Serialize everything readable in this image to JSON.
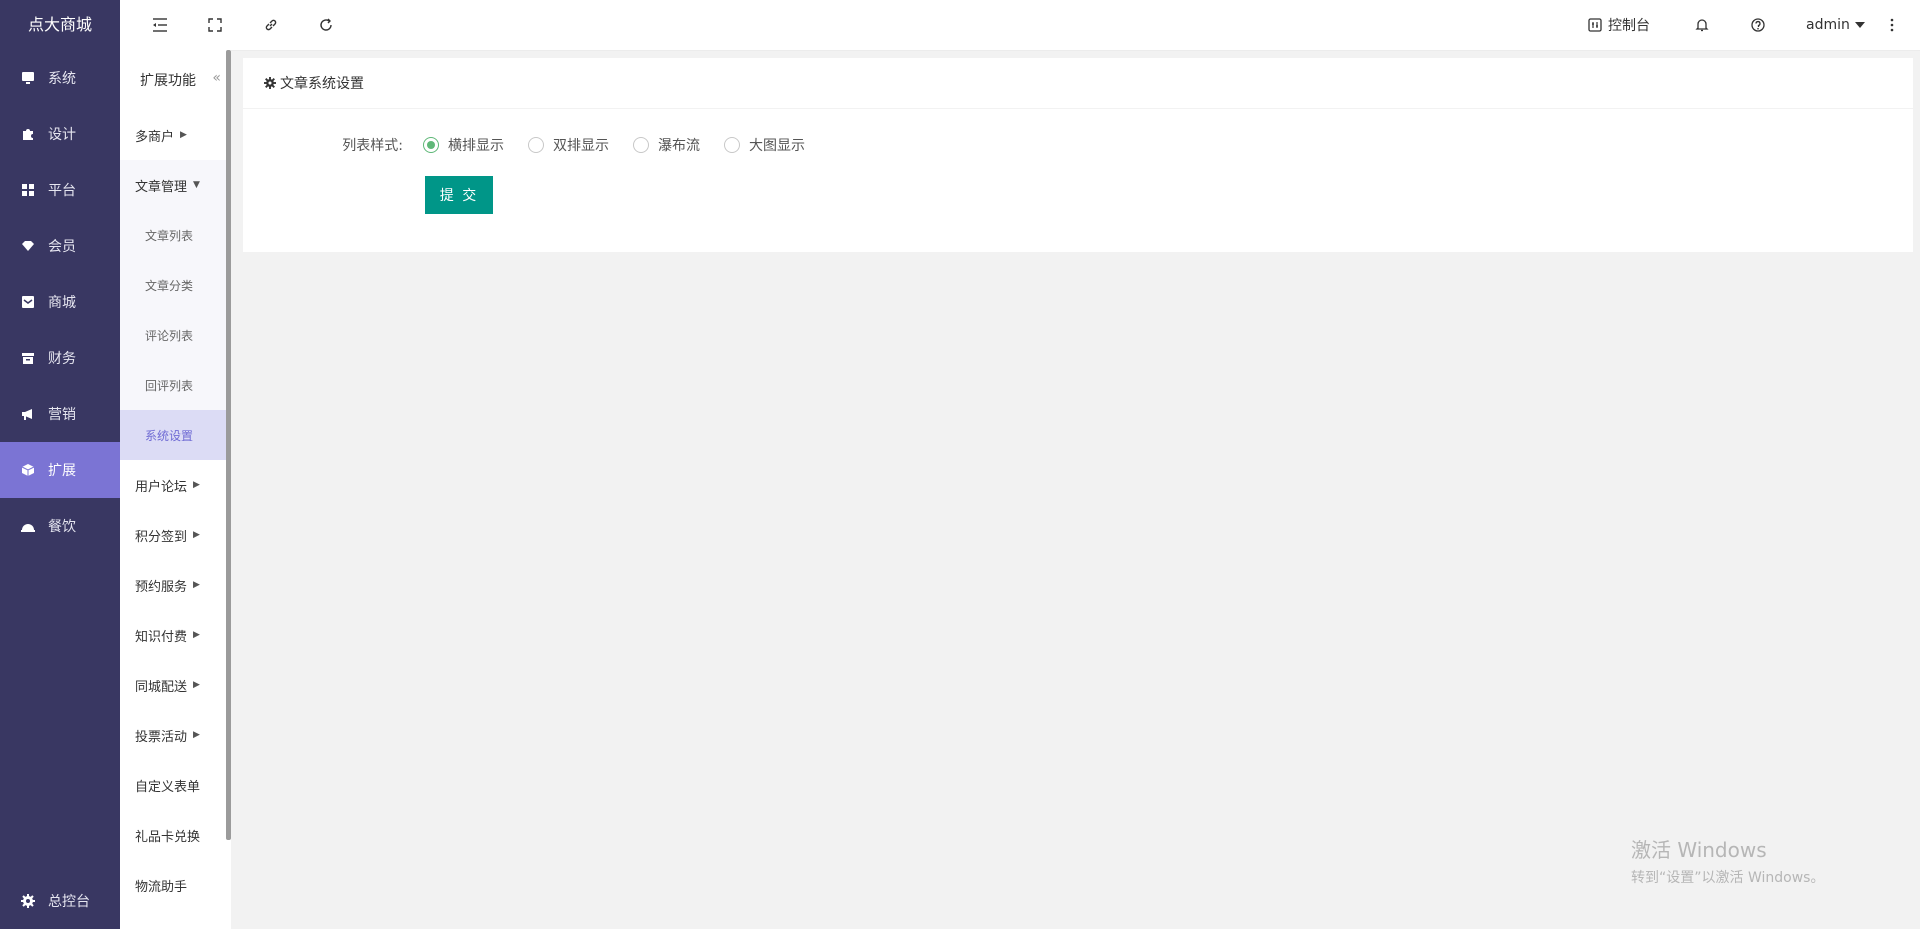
{
  "brand": "点大商城",
  "main_nav": [
    {
      "label": "系统",
      "icon": "monitor-icon"
    },
    {
      "label": "设计",
      "icon": "puzzle-icon"
    },
    {
      "label": "平台",
      "icon": "grid-icon"
    },
    {
      "label": "会员",
      "icon": "gem-icon"
    },
    {
      "label": "商城",
      "icon": "inbox-icon"
    },
    {
      "label": "财务",
      "icon": "archive-icon"
    },
    {
      "label": "营销",
      "icon": "megaphone-icon"
    },
    {
      "label": "扩展",
      "icon": "cube-icon"
    },
    {
      "label": "餐饮",
      "icon": "dish-icon"
    }
  ],
  "main_nav_bottom": "总控台",
  "sub_nav": {
    "title": "扩展功能",
    "collapse": "«",
    "items": [
      {
        "label": "多商户"
      },
      {
        "label": "文章管理"
      },
      {
        "label": "文章列表"
      },
      {
        "label": "文章分类"
      },
      {
        "label": "评论列表"
      },
      {
        "label": "回评列表"
      },
      {
        "label": "系统设置"
      },
      {
        "label": "用户论坛"
      },
      {
        "label": "积分签到"
      },
      {
        "label": "预约服务"
      },
      {
        "label": "知识付费"
      },
      {
        "label": "同城配送"
      },
      {
        "label": "投票活动"
      },
      {
        "label": "自定义表单"
      },
      {
        "label": "礼品卡兑换"
      },
      {
        "label": "物流助手"
      }
    ]
  },
  "topbar": {
    "console": "控制台",
    "user": "admin"
  },
  "card": {
    "title": "文章系统设置",
    "field_label": "列表样式:",
    "options": [
      "横排显示",
      "双排显示",
      "瀑布流",
      "大图显示"
    ],
    "selected": "横排显示",
    "submit": "提 交"
  },
  "watermark": {
    "line1": "激活 Windows",
    "line2": "转到“设置”以激活 Windows。"
  },
  "colors": {
    "sidebar": "#393762",
    "active": "#7b74d4",
    "submit": "#009688",
    "radio": "#5fb878"
  }
}
